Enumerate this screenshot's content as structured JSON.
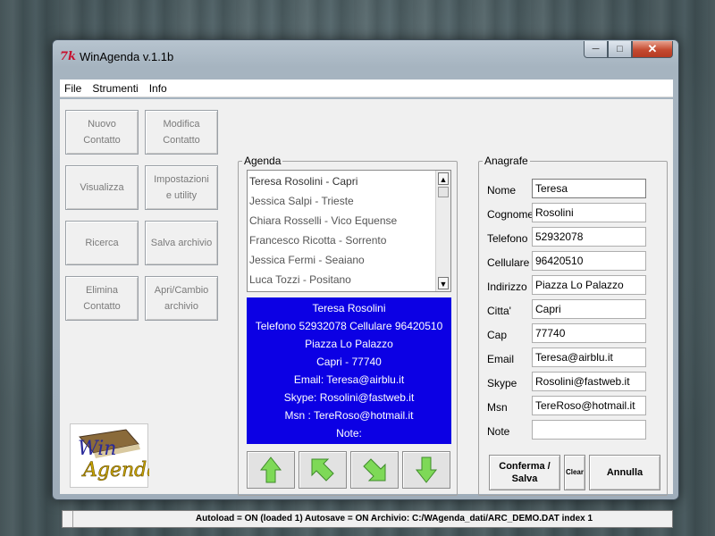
{
  "window": {
    "title": "WinAgenda v.1.1b",
    "icon": "tk-feather-icon"
  },
  "menu": [
    "File",
    "Strumenti",
    "Info"
  ],
  "left_buttons": [
    {
      "label1": "Nuovo",
      "label2": "Contatto"
    },
    {
      "label1": "Modifica",
      "label2": "Contatto"
    },
    {
      "label1": "Visualizza",
      "label2": ""
    },
    {
      "label1": "Impostazioni",
      "label2": "e utility"
    },
    {
      "label1": "Ricerca",
      "label2": ""
    },
    {
      "label1": "Salva archivio",
      "label2": ""
    },
    {
      "label1": "Elimina",
      "label2": "Contatto"
    },
    {
      "label1": "Apri/Cambio",
      "label2": "archivio"
    }
  ],
  "logo": {
    "line1": "Win",
    "line2": "Agenda"
  },
  "agenda": {
    "legend": "Agenda",
    "list": [
      "Teresa Rosolini - Capri",
      "Jessica Salpi - Trieste",
      "Chiara Rosselli - Vico Equense",
      "Francesco Ricotta - Sorrento",
      "Jessica Fermi - Seaiano",
      "Luca Tozzi - Positano"
    ],
    "detail": [
      "Teresa Rosolini",
      "Telefono 52932078 Cellulare 96420510",
      "Piazza Lo Palazzo",
      "Capri - 77740",
      "Email: Teresa@airblu.it",
      "Skype: Rosolini@fastweb.it",
      "Msn  : TereRoso@hotmail.it",
      "Note:"
    ]
  },
  "anagrafe": {
    "legend": "Anagrafe",
    "fields": [
      {
        "label": "Nome",
        "value": "Teresa"
      },
      {
        "label": "Cognome",
        "value": "Rosolini"
      },
      {
        "label": "Telefono",
        "value": "52932078"
      },
      {
        "label": "Cellulare",
        "value": "96420510"
      },
      {
        "label": "Indirizzo",
        "value": "Piazza Lo Palazzo"
      },
      {
        "label": "Citta'",
        "value": "Capri"
      },
      {
        "label": "Cap",
        "value": "77740"
      },
      {
        "label": "Email",
        "value": "Teresa@airblu.it"
      },
      {
        "label": "Skype",
        "value": "Rosolini@fastweb.it"
      },
      {
        "label": "Msn",
        "value": "TereRoso@hotmail.it"
      },
      {
        "label": "Note",
        "value": ""
      }
    ],
    "buttons": {
      "confirm1": "Conferma /",
      "confirm2": "Salva",
      "clear": "Clear",
      "cancel": "Annulla"
    }
  },
  "status": "Autoload = ON (loaded 1) Autosave = ON Archivio: C:/WAgenda_dati/ARC_DEMO.DAT index 1",
  "colors": {
    "detail_bg": "#0c00e4",
    "arrow_green": "#7ed957",
    "close_red": "#c44a30"
  }
}
